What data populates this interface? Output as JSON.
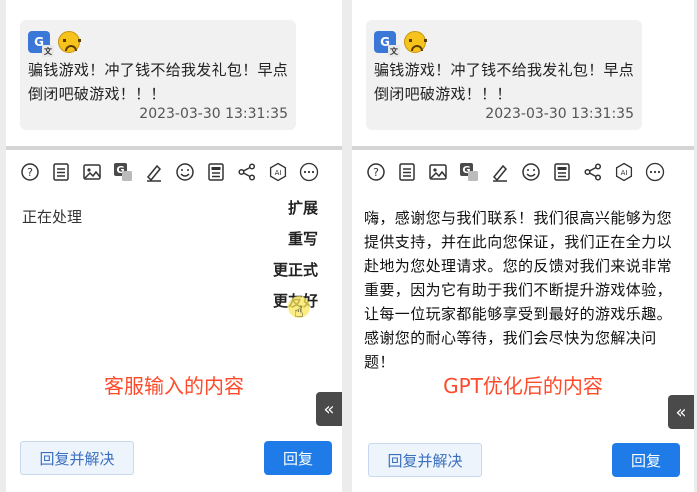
{
  "message": {
    "text": "骗钱游戏！冲了钱不给我发礼包！早点倒闭吧破游戏！！！",
    "timestamp": "2023-03-30 13:31:35"
  },
  "icons": {
    "translate_badge": "G",
    "toolbar": [
      "help-icon",
      "document-icon",
      "image-icon",
      "translate-icon",
      "pen-icon",
      "emoji-icon",
      "clipboard-icon",
      "share-icon",
      "ai-icon",
      "more-icon"
    ],
    "ai_label": "AI"
  },
  "left_panel": {
    "editor_text": "正在处理",
    "menu": [
      "扩展",
      "重写",
      "更正式",
      "更友好"
    ],
    "caption": "客服输入的内容",
    "collapse_label": "«",
    "resolve_button": "回复并解决",
    "reply_button": "回复"
  },
  "right_panel": {
    "editor_text": "嗨，感谢您与我们联系！我们很高兴能够为您提供支持，并在此向您保证，我们正在全力以赴地为您处理请求。您的反馈对我们来说非常重要，因为它有助于我们不断提升游戏体验，让每一位玩家都能够享受到最好的游戏乐趣。感谢您的耐心等待，我们会尽快为您解决问题！",
    "caption": "GPT优化后的内容",
    "collapse_label": "«",
    "resolve_button": "回复并解决",
    "reply_button": "回复"
  },
  "colors": {
    "caption": "#ff4a2a",
    "reply_button": "#1e7be8",
    "resolve_button_text": "#3a6fbf",
    "translate_badge": "#3a77d6"
  }
}
